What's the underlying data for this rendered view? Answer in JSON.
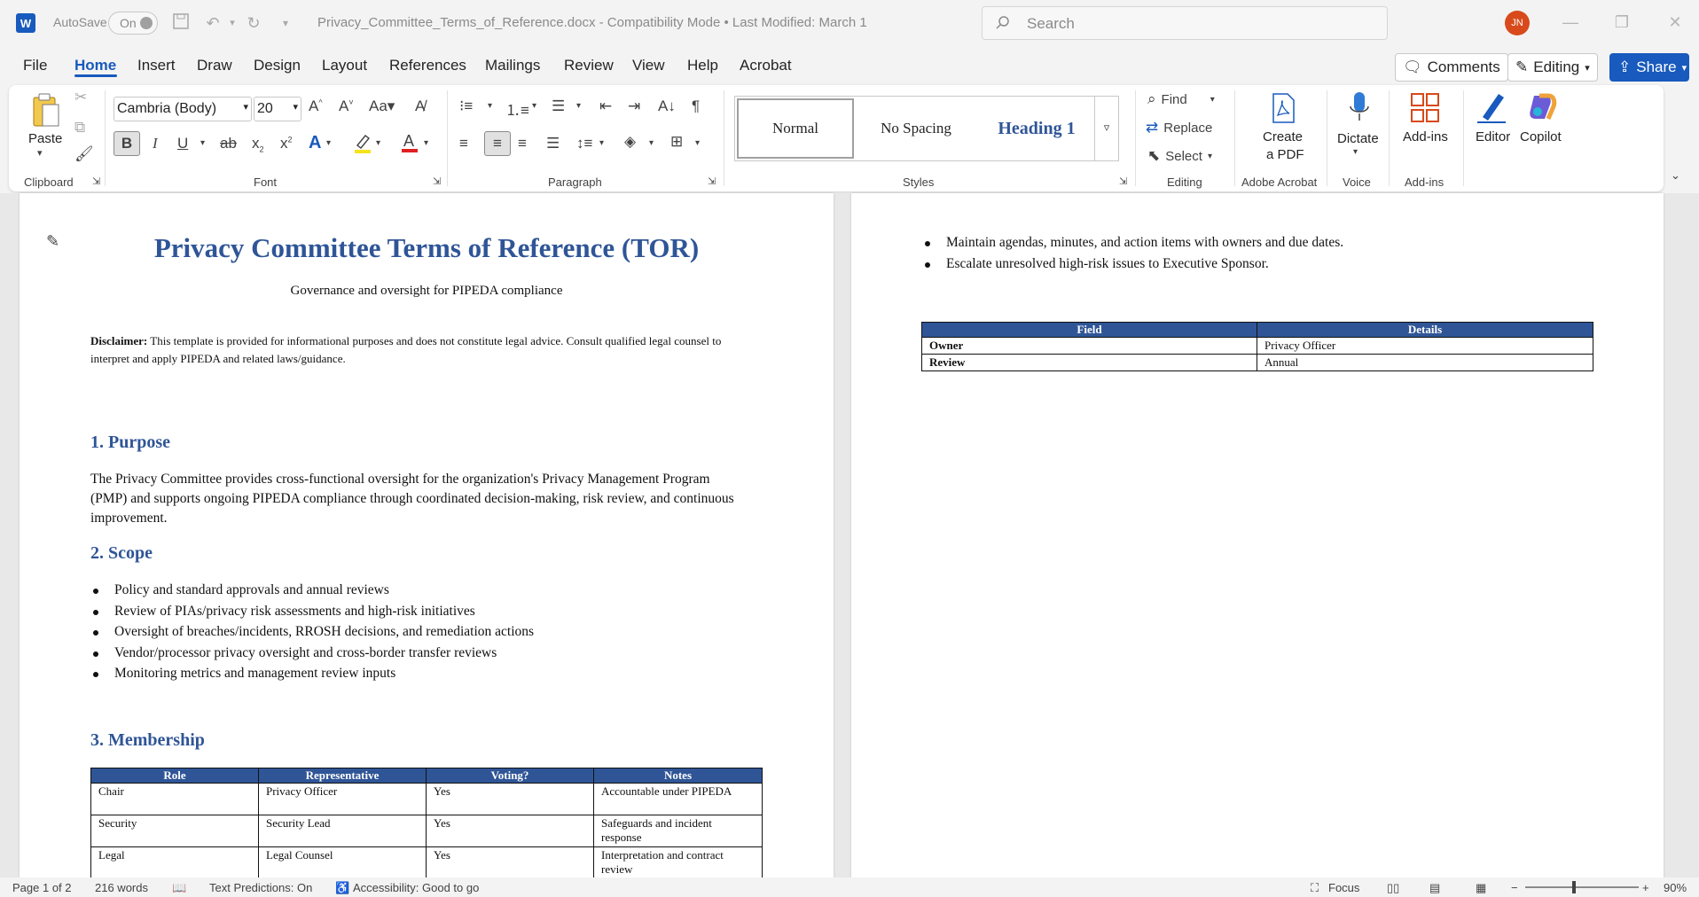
{
  "app": {
    "autosave_label": "AutoSave",
    "autosave_state": "On",
    "doc_title": "Privacy_Committee_Terms_of_Reference.docx  -  Compatibility Mode  •  Last Modified: March 1",
    "search_placeholder": "Search",
    "user_initials": "JN",
    "accent": "#185abd"
  },
  "menu": {
    "tabs": [
      "File",
      "Home",
      "Insert",
      "Draw",
      "Design",
      "Layout",
      "References",
      "Mailings",
      "Review",
      "View",
      "Help",
      "Acrobat"
    ],
    "active_tab": "Home",
    "comments_label": "Comments",
    "editing_label": "Editing",
    "share_label": "Share"
  },
  "ribbon": {
    "clipboard": {
      "paste_label": "Paste",
      "group": "Clipboard"
    },
    "font": {
      "name": "Cambria (Body)",
      "size": "20",
      "group": "Font"
    },
    "paragraph": {
      "group": "Paragraph"
    },
    "styles": {
      "items": [
        "Normal",
        "No Spacing",
        "Heading 1"
      ],
      "group": "Styles"
    },
    "editing": {
      "find": "Find",
      "replace": "Replace",
      "select": "Select",
      "group": "Editing"
    },
    "acrobat": {
      "create_pdf": "Create",
      "create_pdf2": "a PDF",
      "group": "Adobe Acrobat"
    },
    "voice": {
      "dictate": "Dictate",
      "group": "Voice"
    },
    "addins": {
      "addins": "Add-ins",
      "group": "Add-ins"
    },
    "editor": "Editor",
    "copilot": "Copilot"
  },
  "doc": {
    "title": "Privacy Committee Terms of Reference (TOR)",
    "subtitle": "Governance and oversight for PIPEDA compliance",
    "disclaimer_label": "Disclaimer:",
    "disclaimer_text": " This template is provided for informational purposes and does not constitute legal advice. Consult qualified legal counsel to interpret and apply PIPEDA and related laws/guidance.",
    "purpose_heading": "1. Purpose",
    "purpose_text": "The Privacy Committee provides cross-functional oversight for the organization's Privacy Management Program (PMP) and supports ongoing PIPEDA compliance through coordinated decision-making, risk review, and continuous improvement.",
    "scope_heading": "2. Scope",
    "scope_items": [
      "Policy and standard approvals and annual reviews",
      "Review of PIAs/privacy risk assessments and high-risk initiatives",
      "Oversight of breaches/incidents, RROSH decisions, and remediation actions",
      "Vendor/processor privacy oversight and cross-border transfer reviews",
      "Monitoring metrics and management review inputs"
    ],
    "membership_heading": "3. Membership",
    "membership_headers": [
      "Role",
      "Representative",
      "Voting?",
      "Notes"
    ],
    "membership_rows": [
      [
        "Chair",
        "Privacy Officer",
        "Yes",
        "Accountable under PIPEDA"
      ],
      [
        "Security",
        "Security Lead",
        "Yes",
        "Safeguards and incident response"
      ],
      [
        "Legal",
        "Legal Counsel",
        "Yes",
        "Interpretation and contract review"
      ]
    ],
    "page2_items": [
      "Maintain agendas, minutes, and action items with owners and due dates.",
      "Escalate unresolved high-risk issues to Executive Sponsor."
    ],
    "meta_headers": [
      "Field",
      "Details"
    ],
    "meta_rows": [
      [
        "Owner",
        "Privacy Officer"
      ],
      [
        "Review",
        "Annual"
      ]
    ]
  },
  "status": {
    "page": "Page 1 of 2",
    "words": "216 words",
    "predictions": "Text Predictions: On",
    "accessibility": "Accessibility: Good to go",
    "focus": "Focus",
    "zoom": "90%"
  }
}
